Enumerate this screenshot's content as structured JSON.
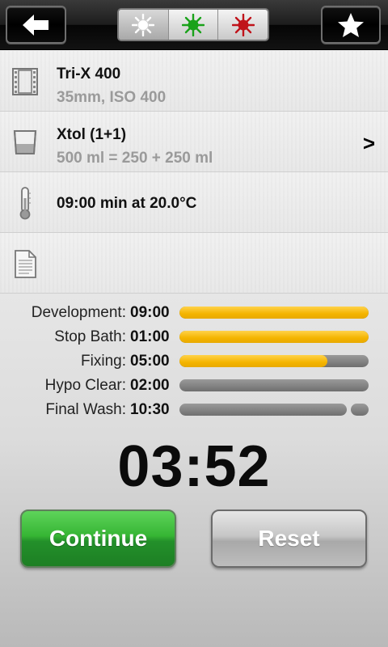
{
  "toolbar": {
    "back_icon": "arrow-left-icon",
    "favorite_icon": "star-icon",
    "safelight_modes": [
      {
        "name": "white",
        "color": "#ffffff",
        "selected": true
      },
      {
        "name": "green",
        "color": "#1aa21a",
        "selected": false
      },
      {
        "name": "red",
        "color": "#c0131a",
        "selected": false
      }
    ]
  },
  "film": {
    "icon": "film-icon",
    "title": "Tri-X 400",
    "subtitle": "35mm, ISO 400"
  },
  "developer": {
    "icon": "beaker-icon",
    "title": "Xtol (1+1)",
    "subtitle": "500 ml = 250 + 250 ml",
    "arrow": ">"
  },
  "temperature": {
    "icon": "thermometer-icon",
    "title": "09:00 min at 20.0°C"
  },
  "notes": {
    "icon": "document-icon"
  },
  "steps": [
    {
      "name": "Development:",
      "time": "09:00",
      "progress": 1.0
    },
    {
      "name": "Stop Bath:",
      "time": "01:00",
      "progress": 1.0
    },
    {
      "name": "Fixing:",
      "time": "05:00",
      "progress": 0.78
    },
    {
      "name": "Hypo Clear:",
      "time": "02:00",
      "progress": 0.0
    },
    {
      "name": "Final Wash:",
      "time": "10:30",
      "progress": 0.0
    }
  ],
  "timer": "03:52",
  "buttons": {
    "continue": "Continue",
    "reset": "Reset"
  },
  "colors": {
    "progress": "#f4b400",
    "continue": "#2fa832",
    "track": "#7c7c7c"
  }
}
